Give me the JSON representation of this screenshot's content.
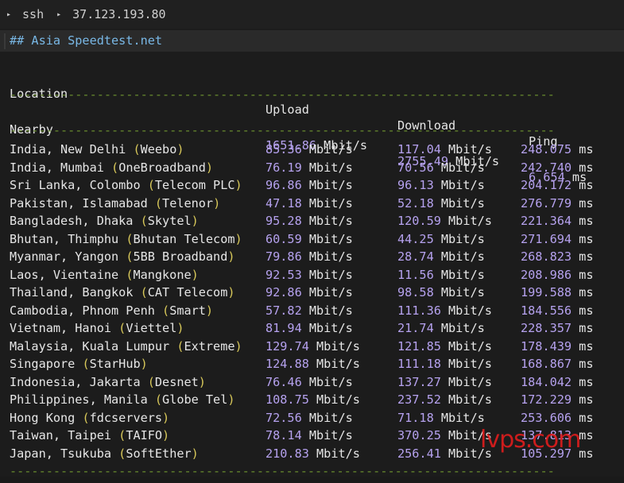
{
  "titlebar": {
    "command": "ssh",
    "host": "37.123.193.80"
  },
  "heading": "## Asia Speedtest.net",
  "columns": {
    "location": "Location",
    "upload": "Upload",
    "download": "Download",
    "ping": "Ping"
  },
  "separator": "---------------------------------------------------------------------------",
  "nearby": {
    "location": "Nearby",
    "upload": "1651.86",
    "download": "2755.49",
    "ping": "6.654"
  },
  "units": {
    "speed": "Mbit/s",
    "ping": "ms"
  },
  "rows": [
    {
      "loc": "India, New Delhi",
      "isp": "Weebo",
      "up": "85.36",
      "down": "117.04",
      "ping": "248.075"
    },
    {
      "loc": "India, Mumbai",
      "isp": "OneBroadband",
      "up": "76.19",
      "down": "70.56",
      "ping": "242.740"
    },
    {
      "loc": "Sri Lanka, Colombo",
      "isp": "Telecom PLC",
      "up": "96.86",
      "down": "96.13",
      "ping": "204.172"
    },
    {
      "loc": "Pakistan, Islamabad",
      "isp": "Telenor",
      "up": "47.18",
      "down": "52.18",
      "ping": "276.779"
    },
    {
      "loc": "Bangladesh, Dhaka",
      "isp": "Skytel",
      "up": "95.28",
      "down": "120.59",
      "ping": "221.364"
    },
    {
      "loc": "Bhutan, Thimphu",
      "isp": "Bhutan Telecom",
      "up": "60.59",
      "down": "44.25",
      "ping": "271.694"
    },
    {
      "loc": "Myanmar, Yangon",
      "isp": "5BB Broadband",
      "up": "79.86",
      "down": "28.74",
      "ping": "268.823"
    },
    {
      "loc": "Laos, Vientaine",
      "isp": "Mangkone",
      "up": "92.53",
      "down": "11.56",
      "ping": "208.986"
    },
    {
      "loc": "Thailand, Bangkok",
      "isp": "CAT Telecom",
      "up": "92.86",
      "down": "98.58",
      "ping": "199.588"
    },
    {
      "loc": "Cambodia, Phnom Penh",
      "isp": "Smart",
      "up": "57.82",
      "down": "111.36",
      "ping": "184.556"
    },
    {
      "loc": "Vietnam, Hanoi",
      "isp": "Viettel",
      "up": "81.94",
      "down": "21.74",
      "ping": "228.357"
    },
    {
      "loc": "Malaysia, Kuala Lumpur",
      "isp": "Extreme",
      "up": "129.74",
      "down": "121.85",
      "ping": "178.439"
    },
    {
      "loc": "Singapore",
      "isp": "StarHub",
      "up": "124.88",
      "down": "111.18",
      "ping": "168.867"
    },
    {
      "loc": "Indonesia, Jakarta",
      "isp": "Desnet",
      "up": "76.46",
      "down": "137.27",
      "ping": "184.042"
    },
    {
      "loc": "Philippines, Manila",
      "isp": "Globe Tel",
      "up": "108.75",
      "down": "237.52",
      "ping": "172.229"
    },
    {
      "loc": "Hong Kong",
      "isp": "fdcservers",
      "up": "72.56",
      "down": "71.18",
      "ping": "253.606"
    },
    {
      "loc": "Taiwan, Taipei",
      "isp": "TAIFO",
      "up": "78.14",
      "down": "370.25",
      "ping": "137.813"
    },
    {
      "loc": "Japan, Tsukuba",
      "isp": "SoftEther",
      "up": "210.83",
      "down": "256.41",
      "ping": "105.297"
    }
  ],
  "watermark": "lvps.com",
  "colors": {
    "background": "#1c1c1c",
    "separator": "#6a8e2e",
    "isp": "#d9c95a",
    "number": "#b6a2ef",
    "heading": "#79b8e6",
    "watermark": "#e11d1d"
  }
}
